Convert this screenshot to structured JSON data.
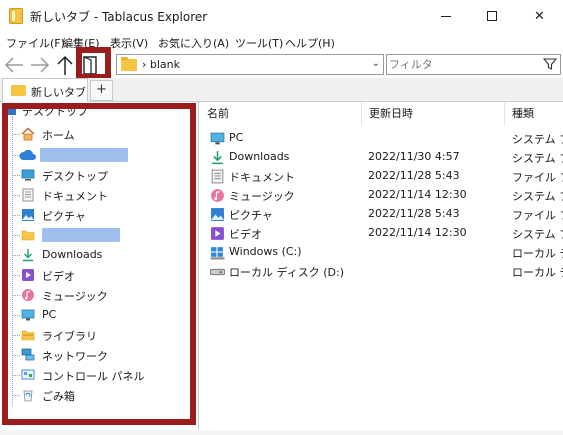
{
  "window": {
    "title": "新しいタブ - Tablacus Explorer",
    "min_label": "",
    "close_label": "✕"
  },
  "menu": [
    "ファイル(F)",
    "編集(E)",
    "表示(V)",
    "お気に入り(A)",
    "ツール(T)",
    "ヘルプ(H)"
  ],
  "address": {
    "path": "› blank",
    "dropdown": "⌄"
  },
  "filter": {
    "placeholder": "フィルタ"
  },
  "tabs": {
    "active": "新しいタブ",
    "add": "+"
  },
  "tree": {
    "items": [
      {
        "label": "デスクトップ",
        "icon": "desktop-blue-icon"
      },
      {
        "label": "ホーム",
        "icon": "home-icon"
      },
      {
        "label": "",
        "icon": "onedrive-cloud-icon"
      },
      {
        "label": "デスクトップ",
        "icon": "desktop-icon"
      },
      {
        "label": "ドキュメント",
        "icon": "document-icon"
      },
      {
        "label": "ピクチャ",
        "icon": "picture-icon"
      },
      {
        "label": "",
        "icon": "folder-icon"
      },
      {
        "label": "Downloads",
        "icon": "download-icon"
      },
      {
        "label": "ビデオ",
        "icon": "video-icon"
      },
      {
        "label": "ミュージック",
        "icon": "music-icon"
      },
      {
        "label": "PC",
        "icon": "pc-icon"
      },
      {
        "label": "ライブラリ",
        "icon": "library-icon"
      },
      {
        "label": "ネットワーク",
        "icon": "network-icon"
      },
      {
        "label": "コントロール パネル",
        "icon": "control-panel-icon"
      },
      {
        "label": "ごみ箱",
        "icon": "recycle-bin-icon"
      }
    ]
  },
  "list": {
    "columns": [
      "名前",
      "更新日時",
      "種類"
    ],
    "rows": [
      {
        "name": "PC",
        "date": "",
        "type": "システム フ",
        "icon": "pc-icon"
      },
      {
        "name": "Downloads",
        "date": "2022/11/30 4:57",
        "type": "システム フ",
        "icon": "download-icon"
      },
      {
        "name": "ドキュメント",
        "date": "2022/11/28 5:43",
        "type": "ファイル フ",
        "icon": "document-icon"
      },
      {
        "name": "ミュージック",
        "date": "2022/11/14 12:30",
        "type": "システム フ",
        "icon": "music-icon"
      },
      {
        "name": "ピクチャ",
        "date": "2022/11/28 5:43",
        "type": "ファイル フ",
        "icon": "picture-icon"
      },
      {
        "name": "ビデオ",
        "date": "2022/11/14 12:30",
        "type": "システム フ",
        "icon": "video-icon"
      },
      {
        "name": "Windows (C:)",
        "date": "",
        "type": "ローカル ディ",
        "icon": "windows-drive-icon"
      },
      {
        "name": "ローカル ディスク (D:)",
        "date": "",
        "type": "ローカル ディ",
        "icon": "disk-drive-icon"
      }
    ]
  },
  "colors": {
    "highlight": "#9b1c1c",
    "redaction": "#9fc0ed"
  }
}
